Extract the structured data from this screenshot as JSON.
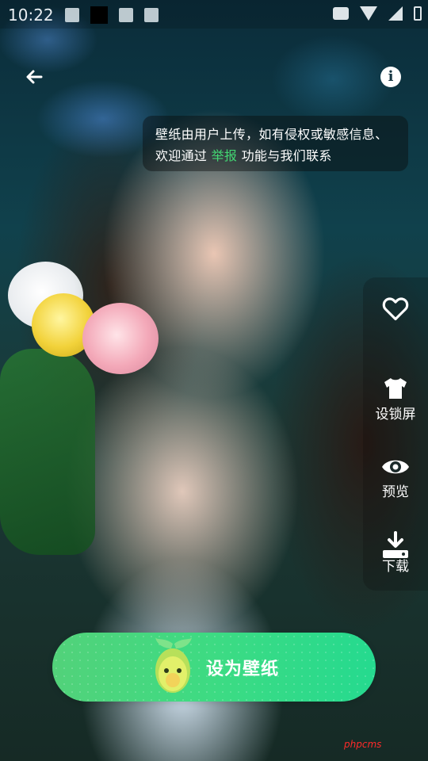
{
  "status_bar": {
    "time": "10:22"
  },
  "notice": {
    "text_before": "壁纸由用户上传，如有侵权或敏感信息、欢迎通过 ",
    "link": "举报",
    "text_after": " 功能与我们联系"
  },
  "actions": [
    {
      "icon": "heart-icon",
      "label": ""
    },
    {
      "icon": "shirt-icon",
      "label": "设锁屏"
    },
    {
      "icon": "eye-icon",
      "label": "预览"
    },
    {
      "icon": "download-icon",
      "label": "下载"
    }
  ],
  "set_button": {
    "label": "设为壁纸",
    "mascot": "avocado-mascot"
  },
  "watermark": "phpcms",
  "colors": {
    "accent": "#43d873",
    "button_start": "#52d27a",
    "button_end": "#25da8f"
  }
}
